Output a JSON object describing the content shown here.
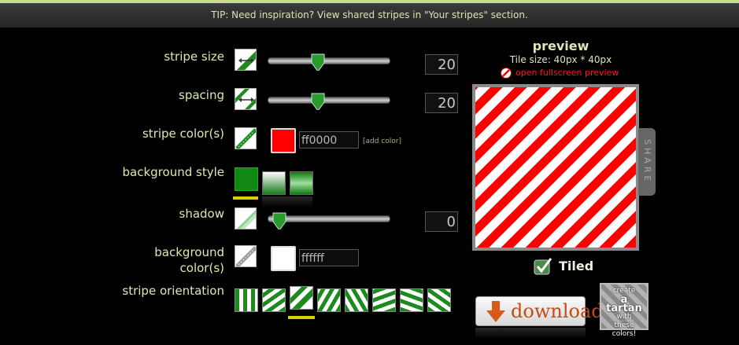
{
  "tip": "TIP: Need inspiration? View shared stripes in \"Your stripes\" section.",
  "controls": {
    "stripe_size": {
      "label": "stripe size",
      "value": "20",
      "slider_fraction": 0.45
    },
    "spacing": {
      "label": "spacing",
      "value": "20",
      "slider_fraction": 0.45
    },
    "stripe_color": {
      "label": "stripe color(s)",
      "hex": "ff0000",
      "add_label": "[add color]",
      "swatch": "#ff0000"
    },
    "background_style": {
      "label": "background style",
      "styles": [
        "solid",
        "gradient-white",
        "gradient-green"
      ],
      "selected": "solid"
    },
    "shadow": {
      "label": "shadow",
      "value": "0",
      "slider_fraction": 0.08
    },
    "background_color": {
      "label_line1": "background",
      "label_line2": "color(s)",
      "hex": "ffffff",
      "swatch": "#ffffff"
    },
    "stripe_orientation": {
      "label": "stripe orientation",
      "options": [
        "vertical",
        "diagonal-left",
        "diagonal-right",
        "diagonal-steep-right",
        "diagonal-steep-left",
        "diagonal-shallow-right",
        "diagonal-shallow-left",
        "diagonal-alt"
      ],
      "selected_index": 2
    }
  },
  "preview": {
    "title": "preview",
    "tile_size": "Tile size: 40px * 40px",
    "fullscreen_link": "open fullscreen preview",
    "share_label": "SHARE",
    "tiled_label": "Tiled",
    "tiled_checked": true
  },
  "actions": {
    "download_label": "download",
    "tartan_line1": "create",
    "tartan_line2": "a tartan",
    "tartan_line3": "with",
    "tartan_line4": "these colors!"
  },
  "colors": {
    "accent": "#d8d000",
    "stripe": "#ff0000",
    "background": "#ffffff",
    "green": "#118811"
  }
}
